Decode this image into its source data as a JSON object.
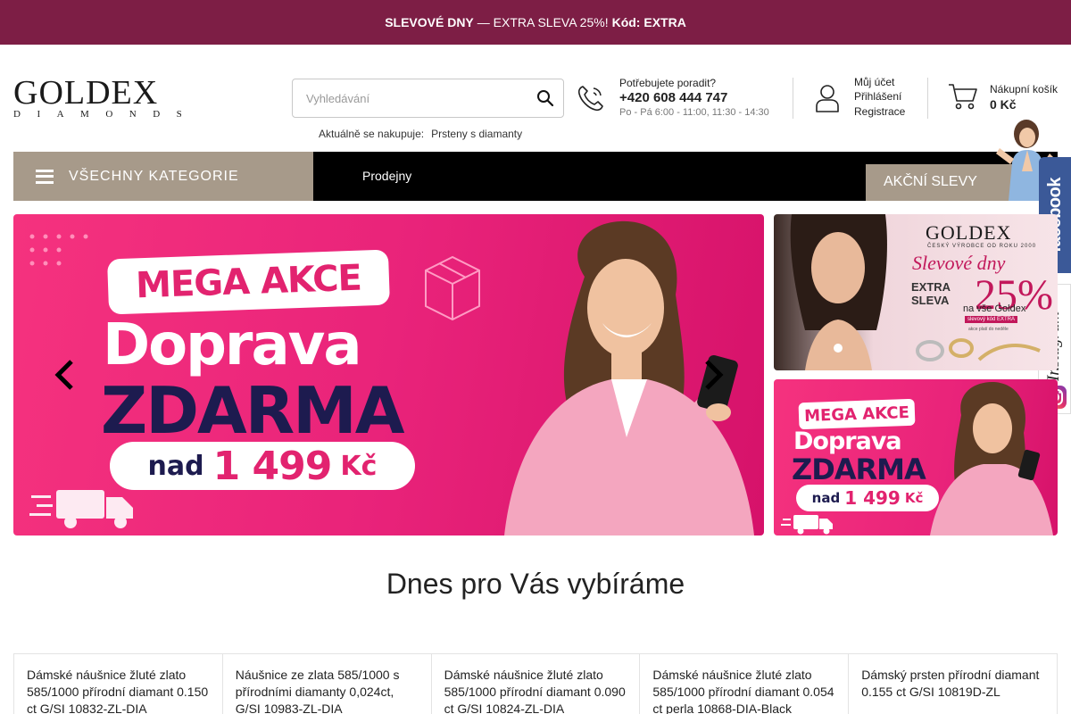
{
  "promo": {
    "icon": "",
    "bold1": "SLEVOVÉ DNY",
    "middle": "— EXTRA SLEVA 25%!",
    "bold2": "Kód: EXTRA"
  },
  "header": {
    "logo_main": "GOLDEX",
    "logo_sub": "DIAMONDS",
    "search_placeholder": "Vyhledávání",
    "current_label": "Aktuálně se nakupuje:",
    "current_value": "Prsteny s diamanty",
    "phone_label": "Potřebujete poradit?",
    "phone_number": "+420 608 444 747",
    "phone_hours": "Po - Pá 6:00 - 11:00, 11:30 - 14:30",
    "account_title": "Můj účet",
    "account_login": "Přihlášení",
    "account_register": "Registrace",
    "cart_label": "Nákupní košík",
    "cart_total": "0 Kč"
  },
  "nav": {
    "categories": "VŠECHNY KATEGORIE",
    "stores": "Prodejny",
    "sale": "AKČNÍ SLEVY"
  },
  "social": {
    "facebook": "facebook",
    "instagram": "Instagram"
  },
  "banner_main": {
    "tag": "MEGA AKCE",
    "line1": "Doprava",
    "line2": "ZDARMA",
    "pill_pre": "nad",
    "pill_amount": "1 499",
    "pill_currency": "Kč"
  },
  "banner_side1": {
    "brand": "GOLDEX",
    "tagline": "ČESKÝ VÝROBCE OD ROKU 2000",
    "title": "Slevové dny",
    "extra": "EXTRA",
    "sleva": "SLEVA",
    "percent": "25%",
    "scope": "na vše Goldex",
    "code": "slevový kód EXTRA",
    "validity": "akce platí do neděle"
  },
  "banner_side2": {
    "tag": "MEGA AKCE",
    "line1": "Doprava",
    "line2": "ZDARMA",
    "pill_pre": "nad",
    "pill_amount": "1 499",
    "pill_currency": "Kč"
  },
  "section": {
    "title": "Dnes pro Vás vybíráme"
  },
  "products": [
    {
      "name": "Dámské náušnice žluté zlato 585/1000 přírodní diamant 0.150 ct G/SI 10832-ZL-DIA"
    },
    {
      "name": "Náušnice ze zlata 585/1000 s přírodními diamanty 0,024ct, G/SI 10983-ZL-DIA"
    },
    {
      "name": "Dámské náušnice žluté zlato 585/1000 přírodní diamant 0.090 ct G/SI 10824-ZL-DIA"
    },
    {
      "name": "Dámské náušnice žluté zlato 585/1000 přírodní diamant 0.054 ct perla 10868-DIA-Black"
    },
    {
      "name": "Dámský prsten přírodní diamant 0.155 ct G/SI 10819D-ZL"
    }
  ],
  "colors": {
    "promo_bg": "#7d1e45",
    "nav_bg": "#000000",
    "category_bg": "#a79a8a",
    "banner_pink": "#e9237a",
    "banner_navy": "#1d1b4f",
    "facebook": "#3b5998"
  }
}
